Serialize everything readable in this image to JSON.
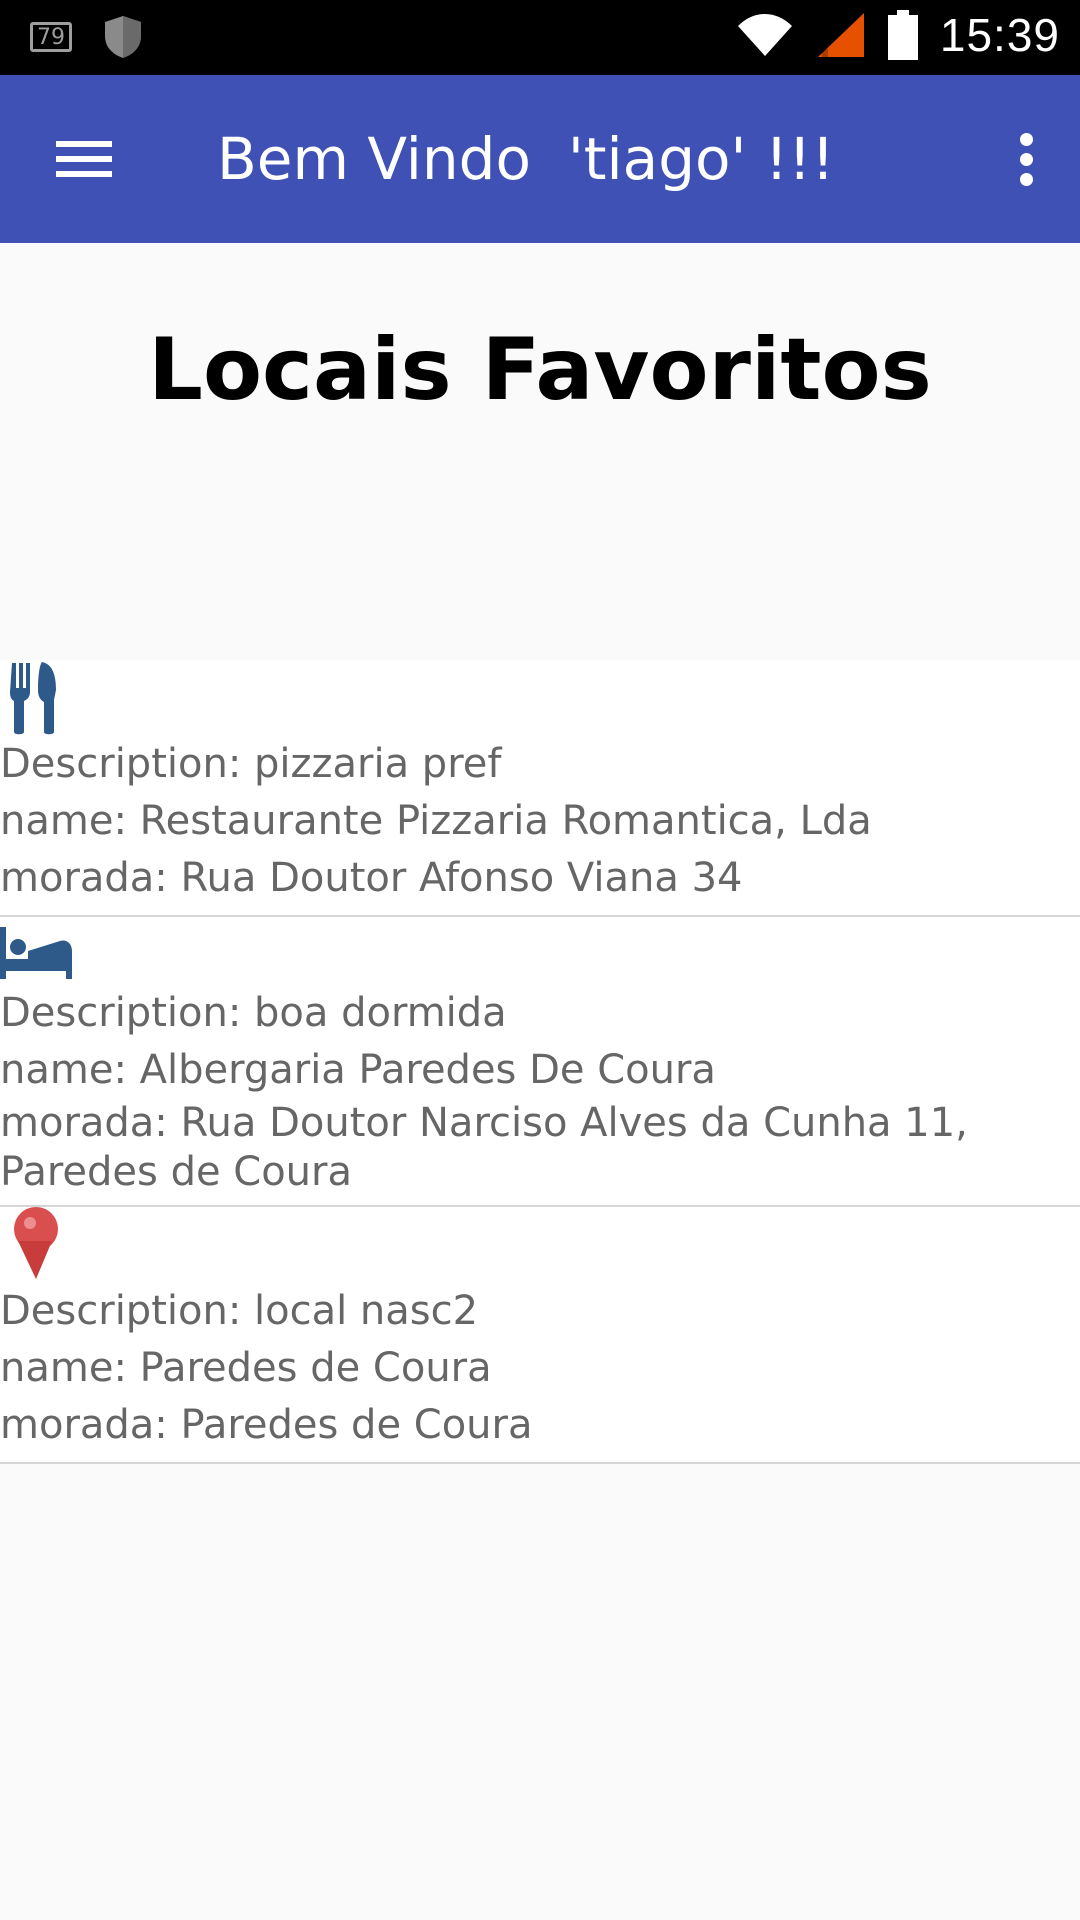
{
  "status_bar": {
    "notification_badge": "79",
    "time": "15:39",
    "icons": [
      "notification-icon",
      "shield-icon",
      "wifi-icon",
      "cell-signal-icon",
      "battery-icon"
    ]
  },
  "app_bar": {
    "title": "Bem Vindo  'tiago' !!!",
    "color": "#3f51b5",
    "menu_icon": "hamburger-menu-icon",
    "overflow_icon": "more-vert-icon"
  },
  "page": {
    "title": "Locais Favoritos"
  },
  "favorites": [
    {
      "icon": "restaurant-icon",
      "description": "Description: pizzaria pref",
      "name": "name: Restaurante Pizzaria Romantica, Lda",
      "morada": "morada: Rua Doutor Afonso Viana 34"
    },
    {
      "icon": "hotel-icon",
      "description": "Description: boa dormida",
      "name": "name: Albergaria Paredes De Coura",
      "morada": "morada: Rua Doutor Narciso Alves da Cunha 11, Paredes de Coura"
    },
    {
      "icon": "map-pin-icon",
      "description": "Description: local nasc2",
      "name": "name: Paredes de Coura",
      "morada": "morada: Paredes de Coura"
    }
  ]
}
